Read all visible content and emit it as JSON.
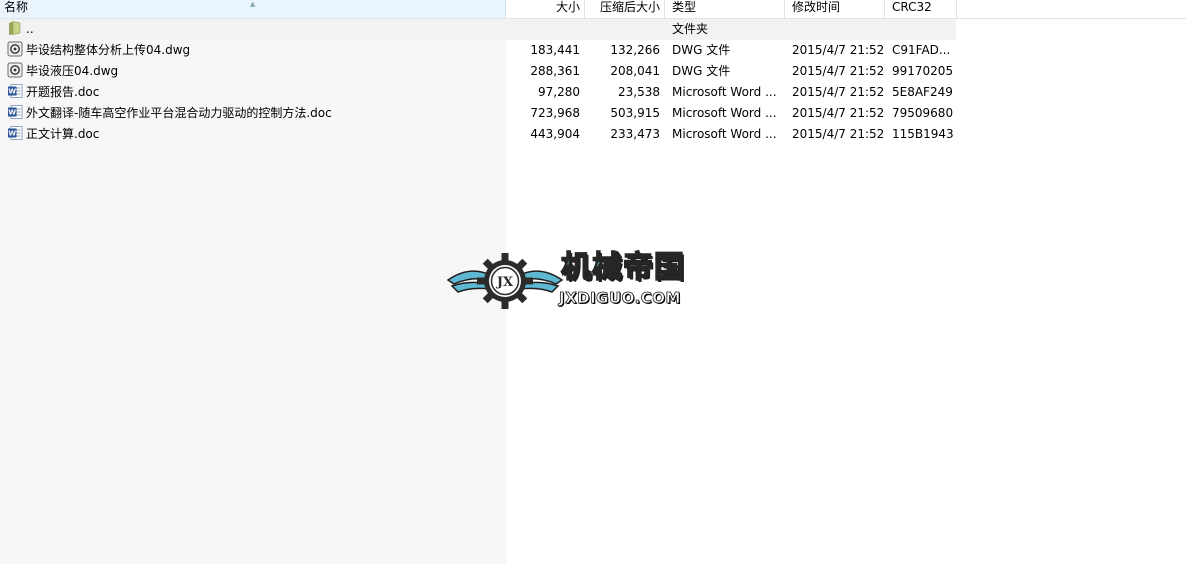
{
  "columns": {
    "name": "名称",
    "size": "大小",
    "packed": "压缩后大小",
    "type": "类型",
    "modified": "修改时间",
    "crc": "CRC32"
  },
  "rows": [
    {
      "icon": "folder-up-icon",
      "name": "..",
      "size": "",
      "packed": "",
      "type": "文件夹",
      "modified": "",
      "crc": ""
    },
    {
      "icon": "dwg-file-icon",
      "name": "毕设结构整体分析上传04.dwg",
      "size": "183,441",
      "packed": "132,266",
      "type": "DWG 文件",
      "modified": "2015/4/7 21:52",
      "crc": "C91FAD..."
    },
    {
      "icon": "dwg-file-icon",
      "name": "毕设液压04.dwg",
      "size": "288,361",
      "packed": "208,041",
      "type": "DWG 文件",
      "modified": "2015/4/7 21:52",
      "crc": "99170205"
    },
    {
      "icon": "word-doc-icon",
      "name": "开题报告.doc",
      "size": "97,280",
      "packed": "23,538",
      "type": "Microsoft Word ...",
      "modified": "2015/4/7 21:52",
      "crc": "5E8AF249"
    },
    {
      "icon": "word-doc-icon",
      "name": "外文翻译-随车高空作业平台混合动力驱动的控制方法.doc",
      "size": "723,968",
      "packed": "503,915",
      "type": "Microsoft Word ...",
      "modified": "2015/4/7 21:52",
      "crc": "79509680"
    },
    {
      "icon": "word-doc-icon",
      "name": "正文计算.doc",
      "size": "443,904",
      "packed": "233,473",
      "type": "Microsoft Word ...",
      "modified": "2015/4/7 21:52",
      "crc": "115B1943"
    }
  ],
  "watermark": {
    "title": "机械帝国",
    "subtitle": "JXDIGUO.COM",
    "emblem_text": "JX"
  },
  "colors": {
    "header_active": "#e9f4fc",
    "name_column_bg": "#f7f7f7",
    "parent_row_bg": "#f2f2f2",
    "folder": "#b5c27a",
    "word_blue": "#2a5699",
    "watermark_accent": "#5fb8d2"
  }
}
